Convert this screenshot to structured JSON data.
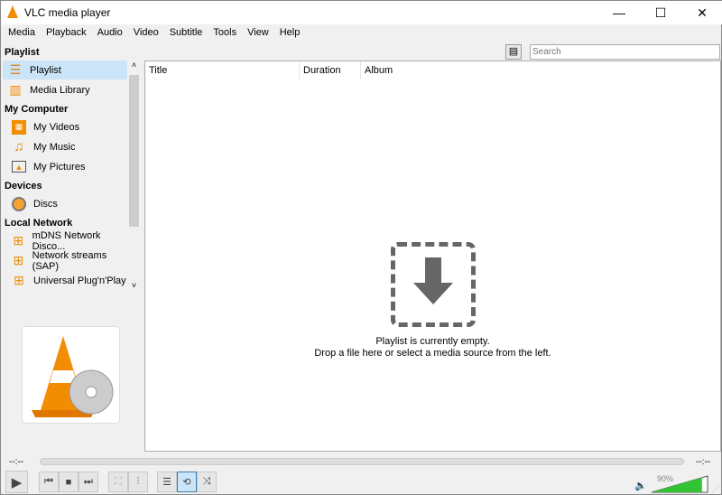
{
  "window": {
    "title": "VLC media player",
    "minimize": "—",
    "maximize": "☐",
    "close": "✕"
  },
  "menu": [
    "Media",
    "Playback",
    "Audio",
    "Video",
    "Subtitle",
    "Tools",
    "View",
    "Help"
  ],
  "search": {
    "placeholder": "Search"
  },
  "sidebar": {
    "sections": [
      {
        "title": "Playlist",
        "items": [
          {
            "label": "Playlist",
            "icon": "playlist-icon",
            "selected": true
          },
          {
            "label": "Media Library",
            "icon": "media-library-icon"
          }
        ]
      },
      {
        "title": "My Computer",
        "items": [
          {
            "label": "My Videos",
            "icon": "film-icon"
          },
          {
            "label": "My Music",
            "icon": "music-note-icon"
          },
          {
            "label": "My Pictures",
            "icon": "picture-icon"
          }
        ]
      },
      {
        "title": "Devices",
        "items": [
          {
            "label": "Discs",
            "icon": "disc-icon"
          }
        ]
      },
      {
        "title": "Local Network",
        "items": [
          {
            "label": "mDNS Network Disco...",
            "icon": "network-icon"
          },
          {
            "label": "Network streams (SAP)",
            "icon": "network-icon"
          },
          {
            "label": "Universal Plug'n'Play",
            "icon": "network-icon"
          }
        ]
      }
    ]
  },
  "playlist": {
    "columns": [
      "Title",
      "Duration",
      "Album"
    ],
    "empty_line1": "Playlist is currently empty.",
    "empty_line2": "Drop a file here or select a media source from the left."
  },
  "player": {
    "elapsed": "--:--",
    "remaining": "--:--",
    "volume": "90%",
    "volume_value": 0.9,
    "accent": "#33c433"
  }
}
